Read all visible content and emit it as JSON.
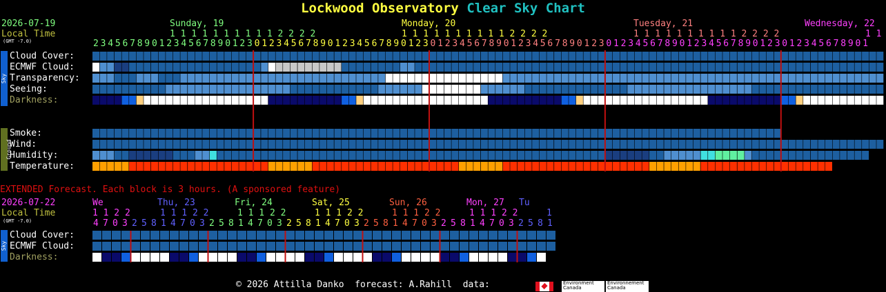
{
  "title": {
    "part1": "Lockwood Observatory",
    "part2": "Clear Sky Chart"
  },
  "header": {
    "date": "2026-07-19",
    "local_time": "Local Time",
    "gmt": "(GMT -7.0)",
    "days": [
      {
        "label": "Sunday, 19",
        "color": "#80ff80"
      },
      {
        "label": "Monday, 20",
        "color": "#ffff40"
      },
      {
        "label": "Tuesday, 21",
        "color": "#ff8080"
      },
      {
        "label": "Wednesday, 22",
        "color": "#ff40ff"
      }
    ],
    "hour_tens": "11111111112222",
    "hours": [
      "2",
      "3",
      "4",
      "5",
      "6",
      "7",
      "8",
      "9",
      "0",
      "1",
      "2",
      "3",
      "4",
      "5",
      "6",
      "7",
      "8",
      "9",
      "0",
      "1",
      "2",
      "3",
      "0",
      "1",
      "2",
      "3",
      "4",
      "5",
      "6",
      "7",
      "8",
      "9",
      "0",
      "1",
      "2",
      "3",
      "4",
      "5",
      "6",
      "7",
      "8",
      "9",
      "0",
      "1",
      "2",
      "3",
      "0",
      "1",
      "2",
      "3",
      "4",
      "5",
      "6",
      "7",
      "8",
      "9",
      "0",
      "1",
      "2",
      "3",
      "4",
      "5",
      "6",
      "7",
      "8",
      "9",
      "0",
      "1",
      "2",
      "3",
      "0",
      "1",
      "2",
      "3",
      "4",
      "5",
      "6",
      "7",
      "8",
      "9",
      "0",
      "1",
      "2",
      "3",
      "4",
      "5",
      "6",
      "7",
      "8",
      "9",
      "0",
      "1",
      "2",
      "3",
      "0",
      "1",
      "2",
      "3",
      "4",
      "5",
      "6",
      "7",
      "8",
      "9",
      "0",
      "1"
    ]
  },
  "side_tabs": {
    "sky": "Sky",
    "ground": "Ground"
  },
  "rows": {
    "cloud_cover": "Cloud Cover:",
    "ecmwf_cloud": "ECMWF Cloud:",
    "transparency": "Transparency:",
    "seeing": "Seeing:",
    "darkness": "Darkness:",
    "smoke": "Smoke:",
    "wind": "Wind:",
    "humidity": "Humidity:",
    "temperature": "Temperature:"
  },
  "extended": {
    "banner": "EXTENDED Forecast. Each block is 3 hours. (A sponsored feature)",
    "date": "2026-07-22",
    "local_time": "Local Time",
    "gmt": "(GMT -7.0)",
    "days": [
      {
        "label": "We",
        "color": "#ff40ff"
      },
      {
        "label": "Thu, 23",
        "color": "#6060ff"
      },
      {
        "label": "Fri, 24",
        "color": "#80ff80"
      },
      {
        "label": "Sat, 25",
        "color": "#ffff40"
      },
      {
        "label": "Sun, 26",
        "color": "#ff6040"
      },
      {
        "label": "Mon, 27",
        "color": "#ff40ff"
      },
      {
        "label": "Tu",
        "color": "#6060ff"
      }
    ],
    "hour_tens": "1122",
    "hours": [
      "4",
      "7",
      "0",
      "3",
      "2",
      "5",
      "8",
      "1",
      "4",
      "7",
      "0",
      "3",
      "2",
      "5",
      "8",
      "1",
      "4",
      "7",
      "0",
      "3",
      "2",
      "5",
      "8",
      "1",
      "4",
      "7",
      "0",
      "3",
      "2",
      "5",
      "8",
      "1",
      "4",
      "7",
      "0",
      "3",
      "2",
      "5",
      "8",
      "1",
      "4",
      "7",
      "0",
      "3",
      "2",
      "5",
      "8",
      "1"
    ],
    "rows": {
      "cloud_cover": "Cloud Cover:",
      "ecmwf_cloud": "ECMWF Cloud:",
      "darkness": "Darkness:"
    }
  },
  "footer": {
    "copyright": "© 2026 Attilla Danko  forecast: A.Rahill  data:",
    "env1": "Environment\nCanada",
    "env2": "Environnement\nCanada"
  },
  "colors": {
    "title1": "#ffff40",
    "title2": "#20c0c0",
    "date": "#80ff80",
    "local": "#c0c040",
    "label": "#ffffff",
    "darkness_label": "#a0a060",
    "midnight_line": "#c01010",
    "extended_banner": "#e01010",
    "sky_tab": "#1060d0",
    "ground_tab": "#607020"
  },
  "chart_data": {
    "type": "heatmap",
    "main_blocks": 108,
    "extended_blocks": 48,
    "main_rows": {
      "cloud_cover": "CCCCCCCCCCCCCCCCCCCCCCCCCCCCCCCCCCCCCCCCCCCCCCCCCCCCCCCCCCCCCCCCCCCCCCCCCCCCCCCCCCCCCCCCCCCCCCCCCCCCCCCCCCCC",
      "ecmwf_cloud": "WLLDDCCCCCCCCCCCCCCCCCCLWTTTTTTTTTCCCCCCCCLLCCCCCCCCCCCCCCCCCCCCCCCCCCCCCCCCCCCCCCCCCCCCCCCCCCCCCCCCCCCCCCCCCC",
      "transparency": "LLLCCCLLLCCCLLLLLLLLLLLLLLLLLLLLLLLLLLLLWWWWWWWWWWWWWWWWLLLLLLLLLLLLLLLLLLLLLLLLLLLLLLLLLLLLLLLLLLLLLLLLLLLL",
      "seeing": "CCCCCCCCCCLLLLLLLLLLLLLLLLLCCCCCCCCCCCCLLLLLLWWWWWWWWLLLLLLCCCCCCCCCCCCCCLLLLLLLLLLLLLLLLLCCCCCCCCCCCCCCCCCCC",
      "darkness": "NNNNBBYWWWWWWWWWWWWWWWWWNNNNNNNNNNBBYWWWWWWWWWWWWWWWWWNNNNNNNNNNBBYWWWWWWWWWWWWWWWWWNNNNNNNNNNBBYWWWWWWWWWWW",
      "smoke": "CCCCCCCCCCCCCCCCCCCCCCCCCCCCCCCCCCCCCCCCCCCCCCCCCCCCCCCCCCCCCCCCCCCCCCCCCCCCCCCCCCCCCCCCCCCCCC..............",
      "wind": "CCCCCCCCCCCCCCCCCCCCCCCCCCCCCCCCCCCCCCCCCCCCCCCCCCCCCCCCCCCCCCCCCCCCCCCCCCCCCCCCCCCCCCCCCCCCCCCCCCCCCCCCCCCC",
      "humidity": "LLLCCDDDDDDCCCLLHCCCCCCCCCCCCCCCCCCCCCCCCCCCCCCCCCCCCCCCCCCCCCCCCCCCCCDDDDDDCCLLLLLHHGGGGLCCCCCCCCCCCCCCCC",
      "temperature": "OOOOORRRRRRRRRRRRRRRRRRROOOOOORRRRRRRRRRRRRRRRRRRROOOOOORRRRRRRRRRRRRRRRRRRROOOOOOORRRRRRRRRRRRRRRRRR"
    },
    "extended_rows": {
      "cloud_cover": "CCCCCCCCCCCCCCCCCCCCCCCCCCCCCCCCCCCCCCCCCCCCCCCC",
      "ecmwf_cloud": "CCCCCCCCCCCCCCCCCCCCCCCCCCCCCCCCCCCCCCCCCCCCCCCC",
      "darkness": "WNNBWWWWNNBWWWWNNBWWWWNNBWWWWNNBWWWWNNBWWWWNNBW"
    },
    "palette": {
      "C": "#1d5fa0",
      "L": "#4f8fd0",
      "T": "#c8c8c8",
      "W": "#ffffff",
      "D": "#1a3e80",
      "N": "#0a0a6a",
      "B": "#1060e0",
      "Y": "#ffd080",
      "H": "#40e0e0",
      "G": "#60f0a0",
      "O": "#ffa000",
      "R": "#ff3000",
      ".": "#000000"
    },
    "main_midnights": [
      22,
      46,
      70,
      94
    ],
    "extended_midnights": [
      4,
      12,
      20,
      28,
      36,
      44
    ]
  }
}
